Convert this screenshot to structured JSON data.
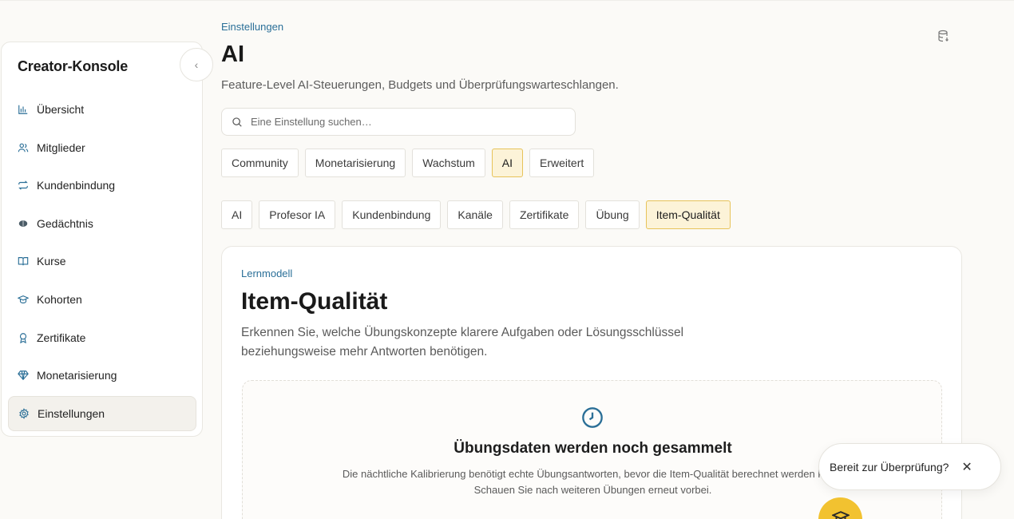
{
  "sidebar": {
    "title": "Creator-Konsole",
    "items": [
      {
        "label": "Übersicht",
        "icon": "bar-chart-icon"
      },
      {
        "label": "Mitglieder",
        "icon": "users-icon"
      },
      {
        "label": "Kundenbindung",
        "icon": "repeat-icon"
      },
      {
        "label": "Gedächtnis",
        "icon": "brain-icon"
      },
      {
        "label": "Kurse",
        "icon": "book-open-icon"
      },
      {
        "label": "Kohorten",
        "icon": "graduation-cap-icon"
      },
      {
        "label": "Zertifikate",
        "icon": "award-icon"
      },
      {
        "label": "Monetarisierung",
        "icon": "gem-icon"
      },
      {
        "label": "Einstellungen",
        "icon": "gear-icon",
        "active": true
      }
    ]
  },
  "header": {
    "breadcrumb": "Einstellungen",
    "title": "AI",
    "subtitle": "Feature-Level AI-Steuerungen, Budgets und Überprüfungswarteschlangen."
  },
  "search": {
    "placeholder": "Eine Einstellung suchen…",
    "value": ""
  },
  "tabs_primary": [
    {
      "label": "Community"
    },
    {
      "label": "Monetarisierung"
    },
    {
      "label": "Wachstum"
    },
    {
      "label": "AI",
      "active": true
    },
    {
      "label": "Erweitert"
    }
  ],
  "tabs_secondary": [
    {
      "label": "AI"
    },
    {
      "label": "Profesor IA"
    },
    {
      "label": "Kundenbindung"
    },
    {
      "label": "Kanäle"
    },
    {
      "label": "Zertifikate"
    },
    {
      "label": "Übung"
    },
    {
      "label": "Item-Qualität",
      "active": true
    }
  ],
  "card": {
    "eyebrow": "Lernmodell",
    "title": "Item-Qualität",
    "description": "Erkennen Sie, welche Übungskonzepte klarere Aufgaben oder Lösungsschlüssel beziehungsweise mehr Antworten benötigen.",
    "empty_state": {
      "icon": "clock-icon",
      "title": "Übungsdaten werden noch gesammelt",
      "text": "Die nächtliche Kalibrierung benötigt echte Übungsantworten, bevor die Item-Qualität berechnet werden kann. Schauen Sie nach weiteren Übungen erneut vorbei."
    }
  },
  "toast": {
    "text": "Bereit zur Überprüfung?",
    "close": "✕"
  },
  "colors": {
    "accent": "#2a6f98",
    "active_tab_bg": "#fcf3d8",
    "active_tab_border": "#e7c35a",
    "fab": "#f2c230"
  }
}
